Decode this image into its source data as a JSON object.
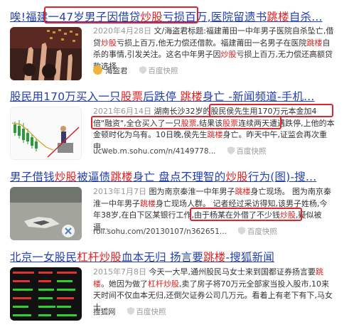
{
  "results": [
    {
      "title_parts": [
        "唉!福建一",
        "47岁男子因借贷",
        "炒股",
        "亏损百万",
        ",医院留遗书",
        "跳楼",
        "自杀..."
      ],
      "date": "2020年4月28日",
      "snippet_parts": [
        "文/海盗君标题:福建莆田一中年男子医院自杀坠亡,借贷",
        "炒股",
        "亏损上百万,他无力偿还借款。福建莆田一名男子在医院",
        "跳楼",
        "自杀的事情,引发关注。这名中年男子因",
        "炒股",
        "亏损上百万,无力偿还高额贷款选择"
      ],
      "source": "海盗君",
      "snapshot": "百度快照"
    },
    {
      "title_parts": [
        "股民用170万买入一只",
        "股票",
        "后跌停 ",
        "跳楼",
        "身亡 -新闻频道-手机..."
      ],
      "date": "2021年6月14日",
      "snippet_parts": [
        "湖南长沙32岁的股民",
        "侯先生用170万元本金加4倍\"融资\",",
        "全仓买入了一只",
        "股票",
        ",结果该",
        "股票",
        "连续两天遭遇跌停,",
        "上他的本金顿时化为乌有。10日晚,侯先生",
        "跳楼",
        "身亡。昨天中午,证监会再次重申..."
      ],
      "source": "ucweb.m.sohu.com/n/4149778...",
      "snapshot": "百度快照"
    },
    {
      "title_parts": [
        "男子借钱",
        "炒股",
        "被逼债",
        "跳楼",
        "身亡 盘点不理智的",
        "炒股",
        "行为(图)-搜..."
      ],
      "date": "2013年1月7日",
      "snippet_parts": [
        "图为南京秦淮一中年男子",
        "跳楼",
        "身亡现场。 图为南京秦淮一中年男子",
        "跳楼",
        "身亡现场人群。 记者经过采访得知,该男子姓杨,今年38岁,在白下区某银行工作,",
        "由于杨某在外借了不少钱",
        "炒股",
        ",疑似被逼..."
      ],
      "source": "roll.sohu.com/20130107/n362651...",
      "snapshot": "百度快照"
    },
    {
      "title_parts": [
        "北京一女股民",
        "杠杆炒股",
        "血本无归 扬言要",
        "跳楼",
        "-搜狐新闻"
      ],
      "date": "2015年7月8日",
      "snippet_parts": [
        "今天一大早,通州股民马女士来到国都证券扬言要",
        "跳楼",
        "。她因为做了",
        "杠杆炒股",
        ",卖了房子将70万元全部家当投入股市,10来天时间不仅血本无归,还倒欠证券公司几万元。看着上有老下有下,马女士..."
      ],
      "source": "搜狐网",
      "snapshot": "百度快照"
    }
  ],
  "colors": {
    "title": "#2440b3",
    "highlight": "#e02020",
    "box": "#e0262c"
  },
  "icons": [
    "shield-icon",
    "source-logo-icon",
    "snapshot-icon"
  ]
}
